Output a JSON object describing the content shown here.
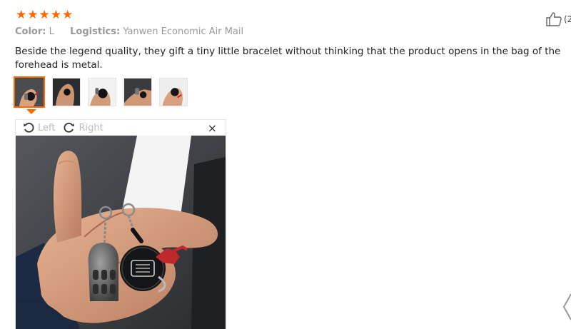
{
  "review": {
    "rating_stars": 5,
    "star_glyph": "★",
    "color_label": "Color:",
    "color_value": "L",
    "logistics_label": "Logistics:",
    "logistics_value": "Yanwen Economic Air Mail",
    "text": "Beside the legend quality, they gift a tiny little bracelet without thinking that the product opens in the bag of the forehead is metal.",
    "like_icon": "thumbs-up-icon",
    "like_count": "(2",
    "accent_color": "#ff6600"
  },
  "gallery": {
    "thumbnail_count": 5,
    "active_index": 0
  },
  "viewer": {
    "rotate_left_label": "Left",
    "rotate_right_label": "Right",
    "close_glyph": "×"
  }
}
